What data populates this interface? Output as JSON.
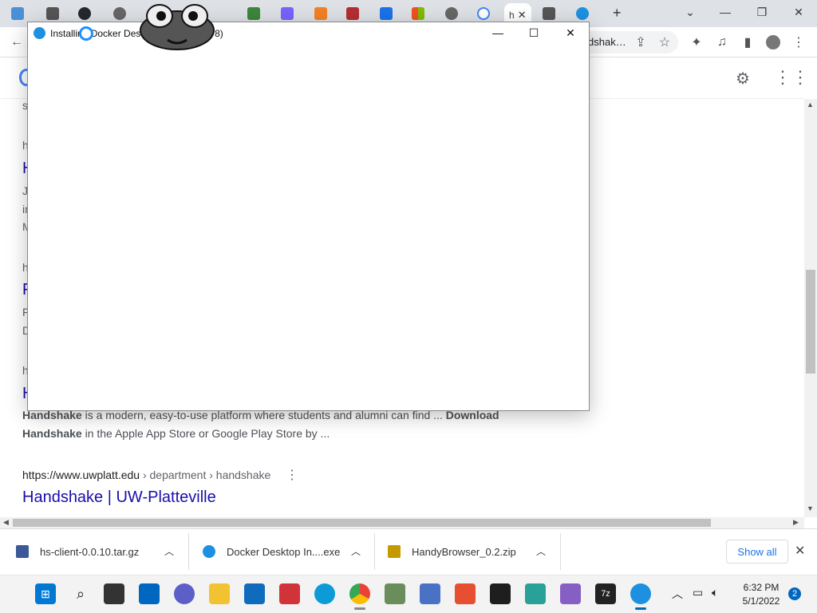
{
  "browser": {
    "active_tab_label": "h",
    "omnibox_text": "dshak…",
    "new_tab": "+"
  },
  "google": {
    "results": [
      {
        "url_host": "https://www.uwplatt.edu",
        "url_path": " › department › handshake",
        "title": "Handshake | UW-Platteville"
      }
    ],
    "snippet_bold_1": "Handshake",
    "snippet_mid": " is a modern, easy-to-use platform where students and alumni can find ... ",
    "snippet_bold_2": "Download",
    "snippet_line2_bold": "Handshake",
    "snippet_line2": " in the Apple App Store or Google Play Store by ...",
    "stubs": [
      "s",
      "h",
      "H",
      "J",
      "in",
      "M",
      "h",
      "F",
      "F",
      "D",
      "h",
      "H"
    ]
  },
  "installer": {
    "title": "Installing Docker Desk",
    "title_tail": "678)"
  },
  "downloads": [
    {
      "name": "hs-client-0.0.10.tar.gz",
      "color": "#3b5998"
    },
    {
      "name": "Docker Desktop In....exe",
      "color": "#1d91e0"
    },
    {
      "name": "HandyBrowser_0.2.zip",
      "color": "#c49a00"
    }
  ],
  "show_all": "Show all",
  "taskbar": {
    "time": "6:32 PM",
    "date": "5/1/2022",
    "notifications": "2"
  },
  "colors": {
    "link": "#1a0dab",
    "accent": "#1a73e8",
    "docker": "#1d91e0"
  }
}
